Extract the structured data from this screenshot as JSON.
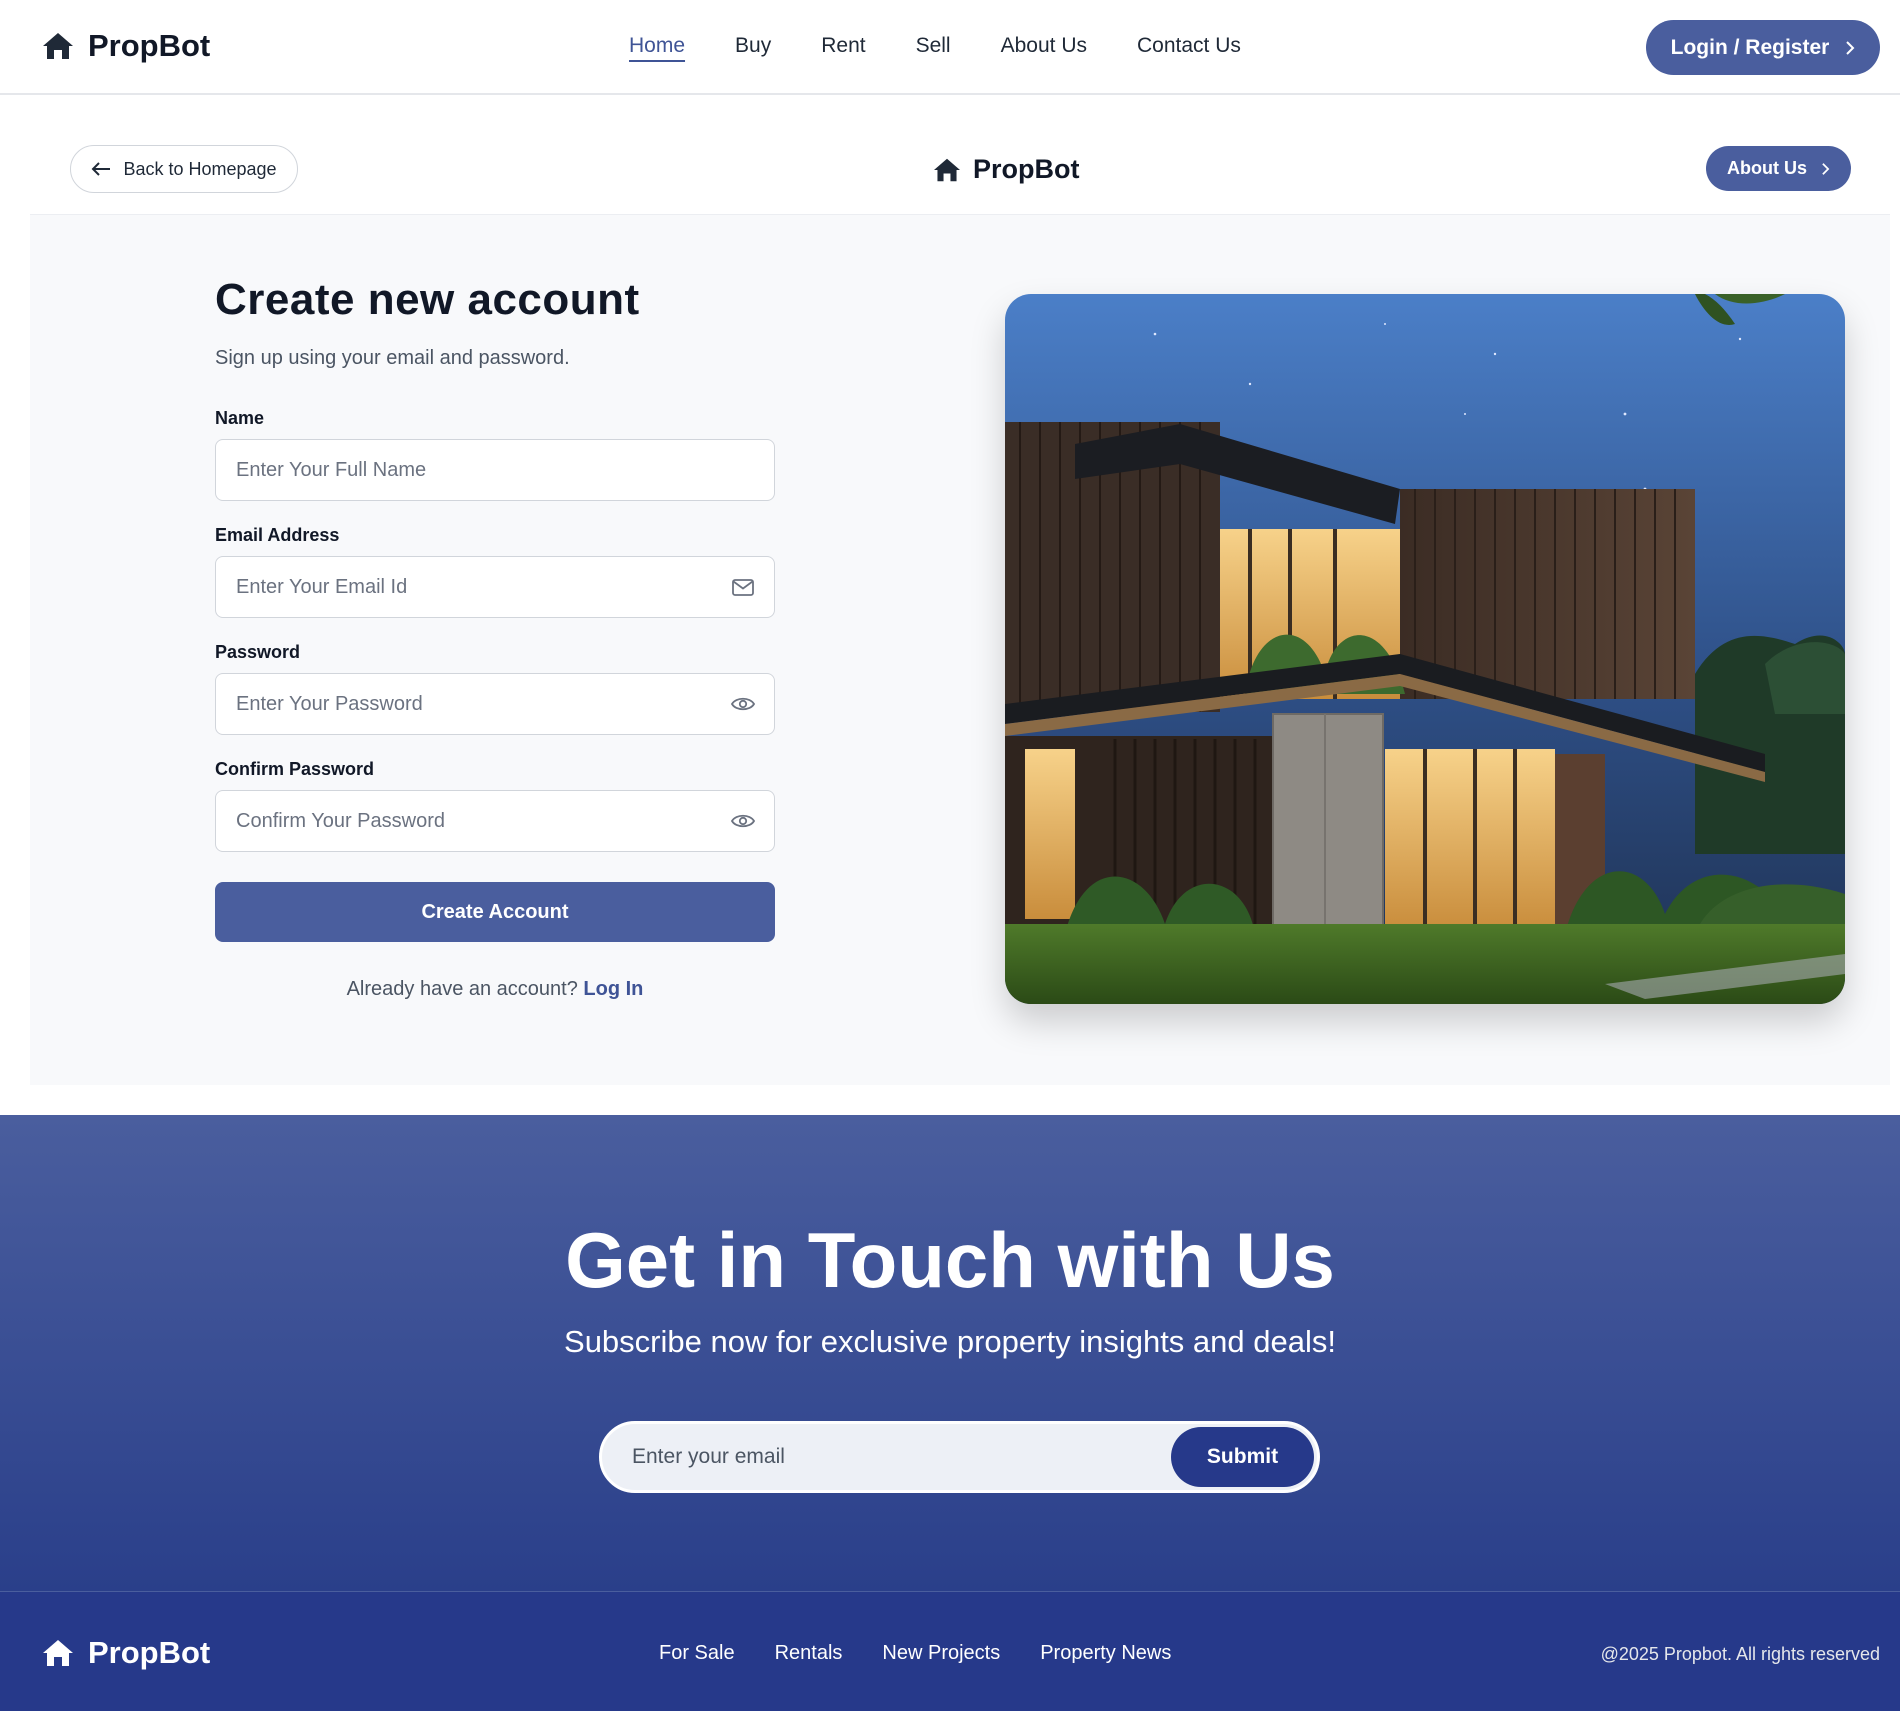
{
  "brand": {
    "name": "PropBot",
    "icon": "home-icon"
  },
  "nav": {
    "links": [
      "Home",
      "Buy",
      "Rent",
      "Sell",
      "About Us",
      "Contact Us"
    ],
    "active": "Home",
    "login_label": "Login / Register"
  },
  "subheader": {
    "back_label": "Back to Homepage",
    "about_label": "About Us"
  },
  "form": {
    "title": "Create new account",
    "subtitle": "Sign up using your email and password.",
    "fields": [
      {
        "label": "Name",
        "placeholder": "Enter Your Full Name",
        "icon": null
      },
      {
        "label": "Email Address",
        "placeholder": "Enter Your Email Id",
        "icon": "mail-icon"
      },
      {
        "label": "Password",
        "placeholder": "Enter Your Password",
        "icon": "eye-icon"
      },
      {
        "label": "Confirm Password",
        "placeholder": "Confirm Your Password",
        "icon": "eye-icon"
      }
    ],
    "submit_label": "Create Account",
    "already_text": "Already have an account?",
    "login_link": "Log In"
  },
  "hero_image": {
    "alt": "Modern house at dusk"
  },
  "newsletter": {
    "title": "Get in Touch with Us",
    "subtitle": "Subscribe now for exclusive property insights and deals!",
    "email_placeholder": "Enter your email",
    "submit_label": "Submit"
  },
  "footer": {
    "links": [
      "For Sale",
      "Rentals",
      "New Projects",
      "Property News"
    ],
    "copyright": "@2025 Propbot. All rights reserved"
  },
  "colors": {
    "accent": "#4a5e9e",
    "dark_accent": "#26398a",
    "link": "#3f5496"
  }
}
